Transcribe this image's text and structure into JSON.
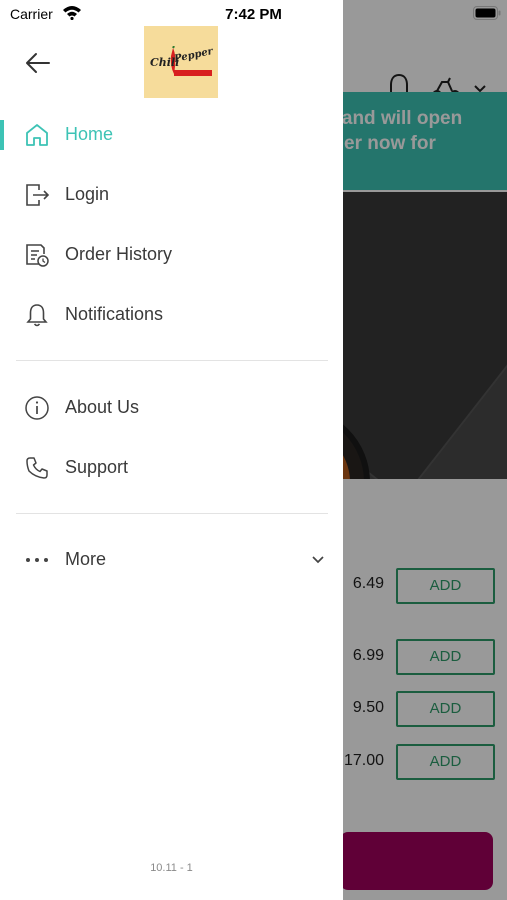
{
  "status_bar": {
    "carrier": "Carrier",
    "time": "7:42 PM"
  },
  "drawer": {
    "logo_text_line1": "Chili",
    "logo_text_line2": "Pepper",
    "items": [
      {
        "label": "Home",
        "icon": "home-icon",
        "active": true
      },
      {
        "label": "Login",
        "icon": "login-icon"
      },
      {
        "label": "Order History",
        "icon": "order-history-icon"
      },
      {
        "label": "Notifications",
        "icon": "bell-icon"
      },
      {
        "label": "About Us",
        "icon": "info-icon"
      },
      {
        "label": "Support",
        "icon": "phone-icon"
      },
      {
        "label": "More",
        "icon": "more-dots-icon"
      }
    ],
    "version": "10.11 - 1"
  },
  "background": {
    "banner_text_line1": "d and will open",
    "banner_text_line2": "rder now for",
    "products": [
      {
        "price": "6.49",
        "add_label": "ADD"
      },
      {
        "price": "6.99",
        "add_label": "ADD"
      },
      {
        "price": "9.50",
        "add_label": "ADD"
      },
      {
        "price": "17.00",
        "add_label": "ADD"
      }
    ]
  },
  "colors": {
    "accent": "#3dc3b5",
    "add_green": "#2e9c6a",
    "cart": "#a0005c"
  }
}
